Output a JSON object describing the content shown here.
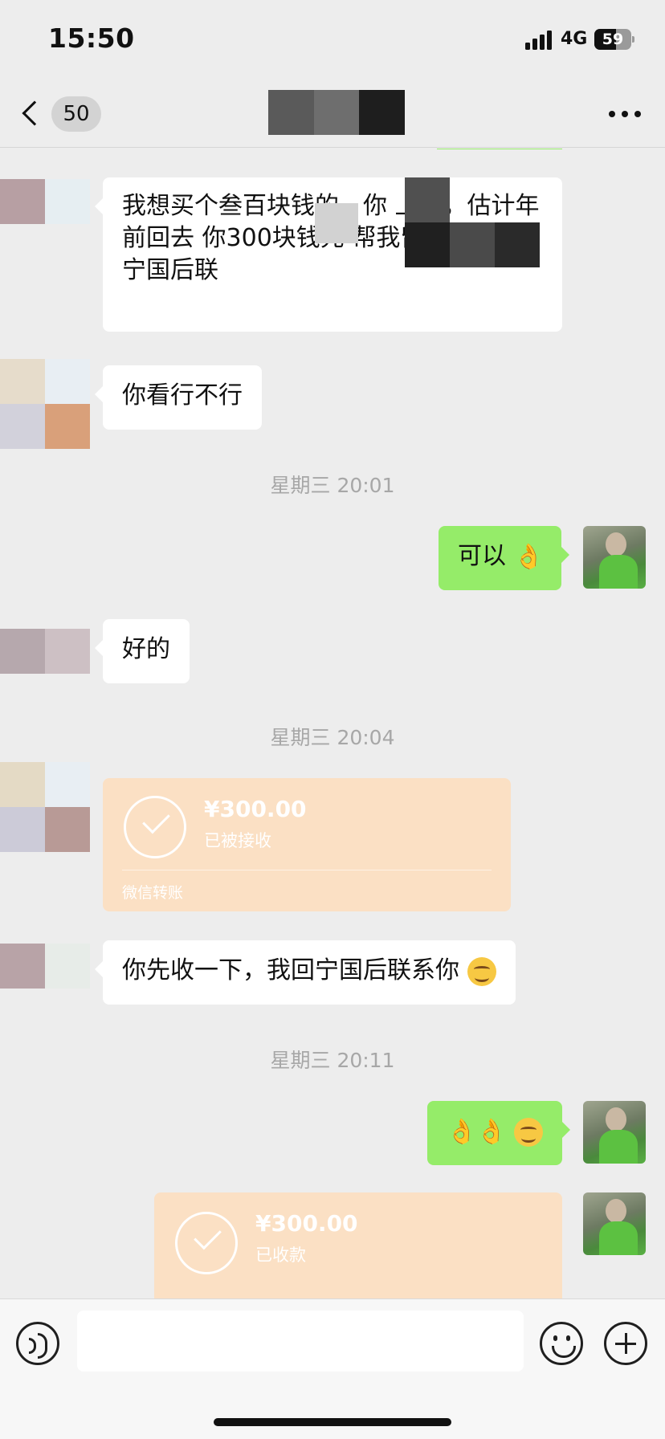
{
  "status_bar": {
    "time": "15:50",
    "network": "4G",
    "battery_level": "59",
    "battery_fraction": 0.59
  },
  "nav": {
    "unread_count": "50",
    "contact_name": "",
    "back_icon": "chevron-left-icon",
    "more_icon": "ellipsis-icon"
  },
  "messages": [
    {
      "type": "text",
      "from": "other",
      "text": "我想买个叁百块钱的，你 上海，估计年前回去 你300块钱先 帮我留着，我回宁国后联"
    },
    {
      "type": "text",
      "from": "other",
      "text": "你看行不行"
    },
    {
      "type": "time",
      "text": "星期三 20:01"
    },
    {
      "type": "text",
      "from": "self",
      "text": "可以",
      "emoji": "👌"
    },
    {
      "type": "text",
      "from": "other",
      "text": "好的"
    },
    {
      "type": "time",
      "text": "星期三 20:04"
    },
    {
      "type": "transfer",
      "from": "other",
      "amount": "¥300.00",
      "status": "已被接收",
      "footer": "微信转账"
    },
    {
      "type": "text",
      "from": "other",
      "text": "你先收一下，我回宁国后联系你"
    },
    {
      "type": "time",
      "text": "星期三 20:11"
    },
    {
      "type": "emoji",
      "from": "self",
      "emoji": "👌👌"
    },
    {
      "type": "transfer",
      "from": "self",
      "amount": "¥300.00",
      "status": "已收款"
    }
  ],
  "input_bar": {
    "placeholder": "",
    "voice_icon": "voice-icon",
    "emoji_icon": "smiley-icon",
    "plus_icon": "plus-icon"
  },
  "colors": {
    "background": "#ededed",
    "self_bubble": "#95ec69",
    "other_bubble": "#ffffff",
    "transfer_card": "#fbe0c4",
    "timestamp": "#a7a7a7"
  }
}
